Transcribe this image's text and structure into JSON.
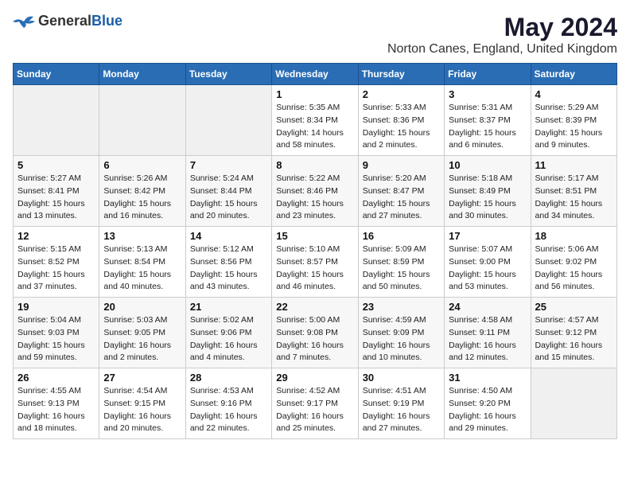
{
  "header": {
    "logo_general": "General",
    "logo_blue": "Blue",
    "title": "May 2024",
    "subtitle": "Norton Canes, England, United Kingdom"
  },
  "days_of_week": [
    "Sunday",
    "Monday",
    "Tuesday",
    "Wednesday",
    "Thursday",
    "Friday",
    "Saturday"
  ],
  "weeks": [
    [
      {
        "day": "",
        "info": ""
      },
      {
        "day": "",
        "info": ""
      },
      {
        "day": "",
        "info": ""
      },
      {
        "day": "1",
        "info": "Sunrise: 5:35 AM\nSunset: 8:34 PM\nDaylight: 14 hours\nand 58 minutes."
      },
      {
        "day": "2",
        "info": "Sunrise: 5:33 AM\nSunset: 8:36 PM\nDaylight: 15 hours\nand 2 minutes."
      },
      {
        "day": "3",
        "info": "Sunrise: 5:31 AM\nSunset: 8:37 PM\nDaylight: 15 hours\nand 6 minutes."
      },
      {
        "day": "4",
        "info": "Sunrise: 5:29 AM\nSunset: 8:39 PM\nDaylight: 15 hours\nand 9 minutes."
      }
    ],
    [
      {
        "day": "5",
        "info": "Sunrise: 5:27 AM\nSunset: 8:41 PM\nDaylight: 15 hours\nand 13 minutes."
      },
      {
        "day": "6",
        "info": "Sunrise: 5:26 AM\nSunset: 8:42 PM\nDaylight: 15 hours\nand 16 minutes."
      },
      {
        "day": "7",
        "info": "Sunrise: 5:24 AM\nSunset: 8:44 PM\nDaylight: 15 hours\nand 20 minutes."
      },
      {
        "day": "8",
        "info": "Sunrise: 5:22 AM\nSunset: 8:46 PM\nDaylight: 15 hours\nand 23 minutes."
      },
      {
        "day": "9",
        "info": "Sunrise: 5:20 AM\nSunset: 8:47 PM\nDaylight: 15 hours\nand 27 minutes."
      },
      {
        "day": "10",
        "info": "Sunrise: 5:18 AM\nSunset: 8:49 PM\nDaylight: 15 hours\nand 30 minutes."
      },
      {
        "day": "11",
        "info": "Sunrise: 5:17 AM\nSunset: 8:51 PM\nDaylight: 15 hours\nand 34 minutes."
      }
    ],
    [
      {
        "day": "12",
        "info": "Sunrise: 5:15 AM\nSunset: 8:52 PM\nDaylight: 15 hours\nand 37 minutes."
      },
      {
        "day": "13",
        "info": "Sunrise: 5:13 AM\nSunset: 8:54 PM\nDaylight: 15 hours\nand 40 minutes."
      },
      {
        "day": "14",
        "info": "Sunrise: 5:12 AM\nSunset: 8:56 PM\nDaylight: 15 hours\nand 43 minutes."
      },
      {
        "day": "15",
        "info": "Sunrise: 5:10 AM\nSunset: 8:57 PM\nDaylight: 15 hours\nand 46 minutes."
      },
      {
        "day": "16",
        "info": "Sunrise: 5:09 AM\nSunset: 8:59 PM\nDaylight: 15 hours\nand 50 minutes."
      },
      {
        "day": "17",
        "info": "Sunrise: 5:07 AM\nSunset: 9:00 PM\nDaylight: 15 hours\nand 53 minutes."
      },
      {
        "day": "18",
        "info": "Sunrise: 5:06 AM\nSunset: 9:02 PM\nDaylight: 15 hours\nand 56 minutes."
      }
    ],
    [
      {
        "day": "19",
        "info": "Sunrise: 5:04 AM\nSunset: 9:03 PM\nDaylight: 15 hours\nand 59 minutes."
      },
      {
        "day": "20",
        "info": "Sunrise: 5:03 AM\nSunset: 9:05 PM\nDaylight: 16 hours\nand 2 minutes."
      },
      {
        "day": "21",
        "info": "Sunrise: 5:02 AM\nSunset: 9:06 PM\nDaylight: 16 hours\nand 4 minutes."
      },
      {
        "day": "22",
        "info": "Sunrise: 5:00 AM\nSunset: 9:08 PM\nDaylight: 16 hours\nand 7 minutes."
      },
      {
        "day": "23",
        "info": "Sunrise: 4:59 AM\nSunset: 9:09 PM\nDaylight: 16 hours\nand 10 minutes."
      },
      {
        "day": "24",
        "info": "Sunrise: 4:58 AM\nSunset: 9:11 PM\nDaylight: 16 hours\nand 12 minutes."
      },
      {
        "day": "25",
        "info": "Sunrise: 4:57 AM\nSunset: 9:12 PM\nDaylight: 16 hours\nand 15 minutes."
      }
    ],
    [
      {
        "day": "26",
        "info": "Sunrise: 4:55 AM\nSunset: 9:13 PM\nDaylight: 16 hours\nand 18 minutes."
      },
      {
        "day": "27",
        "info": "Sunrise: 4:54 AM\nSunset: 9:15 PM\nDaylight: 16 hours\nand 20 minutes."
      },
      {
        "day": "28",
        "info": "Sunrise: 4:53 AM\nSunset: 9:16 PM\nDaylight: 16 hours\nand 22 minutes."
      },
      {
        "day": "29",
        "info": "Sunrise: 4:52 AM\nSunset: 9:17 PM\nDaylight: 16 hours\nand 25 minutes."
      },
      {
        "day": "30",
        "info": "Sunrise: 4:51 AM\nSunset: 9:19 PM\nDaylight: 16 hours\nand 27 minutes."
      },
      {
        "day": "31",
        "info": "Sunrise: 4:50 AM\nSunset: 9:20 PM\nDaylight: 16 hours\nand 29 minutes."
      },
      {
        "day": "",
        "info": ""
      }
    ]
  ]
}
